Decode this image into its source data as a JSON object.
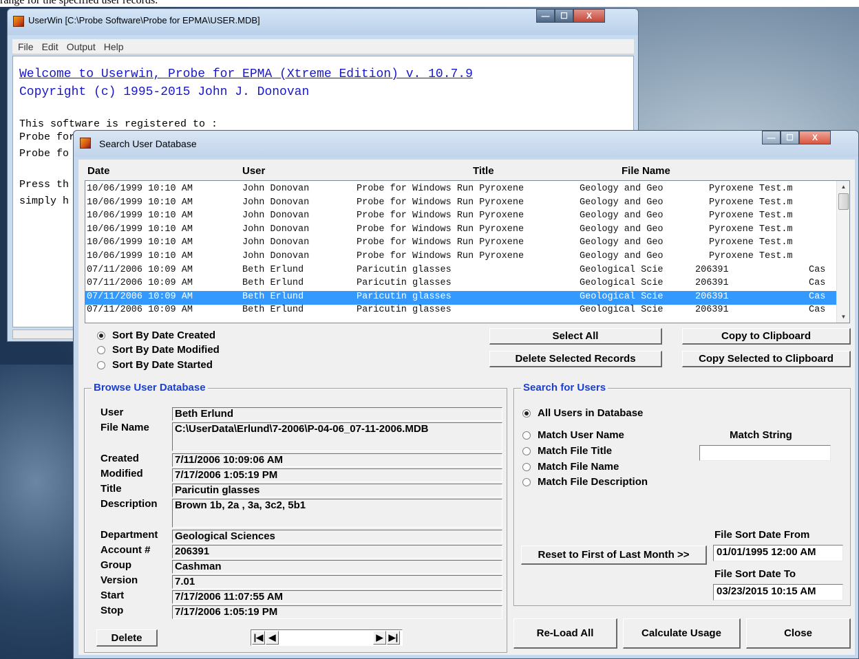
{
  "caption": "range for the specified user records.",
  "main_window": {
    "title": "UserWin [C:\\Probe Software\\Probe for EPMA\\USER.MDB]",
    "menu": [
      "File",
      "Edit",
      "Output",
      "Help"
    ],
    "welcome_line": "Welcome to Userwin, Probe for EPMA (Xtreme Edition) v. 10.7.9",
    "copyright_line": "Copyright (c) 1995-2015 John J. Donovan",
    "registered_line": "This software is registered to :",
    "line_probe_1": "Probe for EPMA",
    "line_probe_2": "Probe fo",
    "line_press": "Press th",
    "line_simply": "simply h",
    "caption_buttons": {
      "minimize": "—",
      "maximize": "☐",
      "close": "X"
    }
  },
  "dialog": {
    "title": "Search User Database",
    "caption_buttons": {
      "minimize": "—",
      "maximize": "☐",
      "close": "X"
    },
    "columns": {
      "date": "Date",
      "user": "User",
      "title": "Title",
      "file_name": "File Name"
    },
    "records": [
      {
        "date": "10/06/1999 10:10 AM",
        "user": "John Donovan",
        "title": "Probe for Windows Run Pyroxene",
        "dept": "Geology and Geo",
        "account": "",
        "file": "Pyroxene Test.m",
        "group": ""
      },
      {
        "date": "10/06/1999 10:10 AM",
        "user": "John Donovan",
        "title": "Probe for Windows Run Pyroxene",
        "dept": "Geology and Geo",
        "account": "",
        "file": "Pyroxene Test.m",
        "group": ""
      },
      {
        "date": "10/06/1999 10:10 AM",
        "user": "John Donovan",
        "title": "Probe for Windows Run Pyroxene",
        "dept": "Geology and Geo",
        "account": "",
        "file": "Pyroxene Test.m",
        "group": ""
      },
      {
        "date": "10/06/1999 10:10 AM",
        "user": "John Donovan",
        "title": "Probe for Windows Run Pyroxene",
        "dept": "Geology and Geo",
        "account": "",
        "file": "Pyroxene Test.m",
        "group": ""
      },
      {
        "date": "10/06/1999 10:10 AM",
        "user": "John Donovan",
        "title": "Probe for Windows Run Pyroxene",
        "dept": "Geology and Geo",
        "account": "",
        "file": "Pyroxene Test.m",
        "group": ""
      },
      {
        "date": "10/06/1999 10:10 AM",
        "user": "John Donovan",
        "title": "Probe for Windows Run Pyroxene",
        "dept": "Geology and Geo",
        "account": "",
        "file": "Pyroxene Test.m",
        "group": ""
      },
      {
        "date": "07/11/2006 10:09 AM",
        "user": "Beth Erlund",
        "title": "Paricutin glasses",
        "dept": "Geological Scie",
        "account": "206391",
        "file": "",
        "group": "Cas"
      },
      {
        "date": "07/11/2006 10:09 AM",
        "user": "Beth Erlund",
        "title": "Paricutin glasses",
        "dept": "Geological Scie",
        "account": "206391",
        "file": "",
        "group": "Cas"
      },
      {
        "date": "07/11/2006 10:09 AM",
        "user": "Beth Erlund",
        "title": "Paricutin glasses",
        "dept": "Geological Scie",
        "account": "206391",
        "file": "",
        "group": "Cas"
      },
      {
        "date": "07/11/2006 10:09 AM",
        "user": "Beth Erlund",
        "title": "Paricutin glasses",
        "dept": "Geological Scie",
        "account": "206391",
        "file": "",
        "group": "Cas"
      }
    ],
    "selected_index": 8,
    "sort": {
      "created": "Sort By Date Created",
      "modified": "Sort By Date Modified",
      "started": "Sort By Date Started"
    },
    "buttons": {
      "select_all": "Select All",
      "copy_clipboard": "Copy to Clipboard",
      "delete_selected": "Delete Selected Records",
      "copy_selected": "Copy Selected to Clipboard",
      "reset_month": "Reset to First of Last Month >>",
      "reload_all": "Re-Load All",
      "calc_usage": "Calculate Usage",
      "close": "Close",
      "delete": "Delete"
    },
    "browse": {
      "title": "Browse User Database",
      "labels": {
        "user": "User",
        "file_name": "File Name",
        "created": "Created",
        "modified": "Modified",
        "title": "Title",
        "description": "Description",
        "department": "Department",
        "account": "Account #",
        "group": "Group",
        "version": "Version",
        "start": "Start",
        "stop": "Stop"
      },
      "values": {
        "user": "Beth Erlund",
        "file_name": "C:\\UserData\\Erlund\\7-2006\\P-04-06_07-11-2006.MDB",
        "created": "7/11/2006 10:09:06 AM",
        "modified": "7/17/2006 1:05:19 PM",
        "title": "Paricutin glasses",
        "description": "Brown 1b, 2a , 3a, 3c2, 5b1",
        "department": "Geological Sciences",
        "account": "206391",
        "group": "Cashman",
        "version": "7.01",
        "start": "7/17/2006 11:07:55 AM",
        "stop": "7/17/2006 1:05:19 PM"
      },
      "nav": {
        "first": "|◀",
        "prev": "◀",
        "next": "▶",
        "last": "▶|"
      }
    },
    "search": {
      "title": "Search for Users",
      "all_users": "All Users in Database",
      "match_user": "Match User Name",
      "match_title": "Match File Title",
      "match_name": "Match File Name",
      "match_desc": "Match File Description",
      "match_string_label": "Match String",
      "match_string_value": "",
      "date_from_label": "File Sort Date From",
      "date_from": "01/01/1995 12:00 AM",
      "date_to_label": "File Sort Date To",
      "date_to": "03/23/2015 10:15 AM"
    }
  }
}
